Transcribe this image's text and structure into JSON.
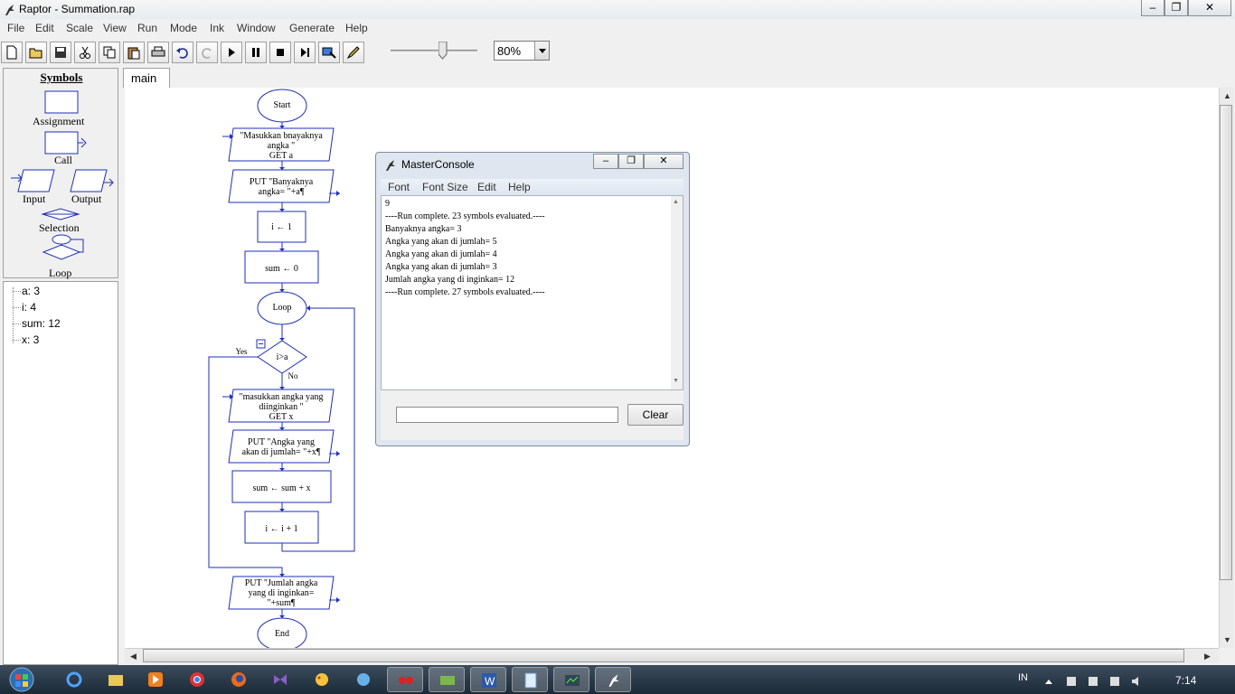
{
  "window": {
    "title": "Raptor - Summation.rap"
  },
  "menu": [
    "File",
    "Edit",
    "Scale",
    "View",
    "Run",
    "Mode",
    "Ink",
    "Window",
    "Generate",
    "Help"
  ],
  "toolbar": {
    "buttons": [
      "new-icon",
      "open-icon",
      "save-icon",
      "cut-icon",
      "copy-icon",
      "paste-icon",
      "print-icon",
      "undo-icon",
      "redo-icon",
      "play-icon",
      "pause-icon",
      "stop-icon",
      "step-icon",
      "test-server-icon",
      "pen-icon"
    ],
    "zoom": "80%",
    "speed_level": 0.6
  },
  "symbols": {
    "title": "Symbols",
    "items": {
      "assignment": "Assignment",
      "call": "Call",
      "input": "Input",
      "output": "Output",
      "selection": "Selection",
      "loop": "Loop"
    }
  },
  "variables": [
    "a: 3",
    "i: 4",
    "sum: 12",
    "x: 3"
  ],
  "tab": {
    "label": "main"
  },
  "flowchart": {
    "start": "Start",
    "input1": [
      "\"Masukkan bnayaknya",
      "angka \"",
      "GET a"
    ],
    "output1": [
      "PUT \"Banyaknya",
      "angka= \"+a¶"
    ],
    "assign1": "i ← 1",
    "assign2": "sum ← 0",
    "loop": "Loop",
    "decision": "i>a",
    "yes": "Yes",
    "no": "No",
    "input2": [
      "\"masukkan angka yang",
      "diinginkan \"",
      "GET x"
    ],
    "output2": [
      "PUT \"Angka yang",
      "akan di jumlah= \"+x¶"
    ],
    "assign3": "sum ← sum + x",
    "assign4": "i ← i + 1",
    "output3": [
      "PUT \"Jumlah angka",
      "yang di inginkan=",
      "\"+sum¶"
    ],
    "end": "End"
  },
  "console": {
    "title": "MasterConsole",
    "menu": [
      "Font",
      "Font Size",
      "Edit",
      "Help"
    ],
    "lines": [
      "9",
      "----Run complete.  23 symbols evaluated.----",
      "Banyaknya angka= 3",
      "Angka yang akan di jumlah= 5",
      "Angka yang akan di jumlah= 4",
      "Angka yang akan di jumlah= 3",
      "Jumlah angka yang di inginkan= 12",
      "----Run complete.  27 symbols evaluated.----"
    ],
    "input_value": "",
    "clear_label": "Clear"
  },
  "taskbar": {
    "apps": [
      "start-orb-icon",
      "ie-icon",
      "explorer-icon",
      "media-player-icon",
      "chrome-icon",
      "firefox-icon",
      "visual-studio-icon",
      "paint-icon",
      "app-icon",
      "connect-icon",
      "media-icon",
      "word-icon",
      "notepad-icon",
      "cpu-icon",
      "raptor-icon"
    ],
    "lang": "IN",
    "clock": "7:14"
  },
  "colors": {
    "flow": "#1f2fb8",
    "accent": "#0000cc"
  }
}
